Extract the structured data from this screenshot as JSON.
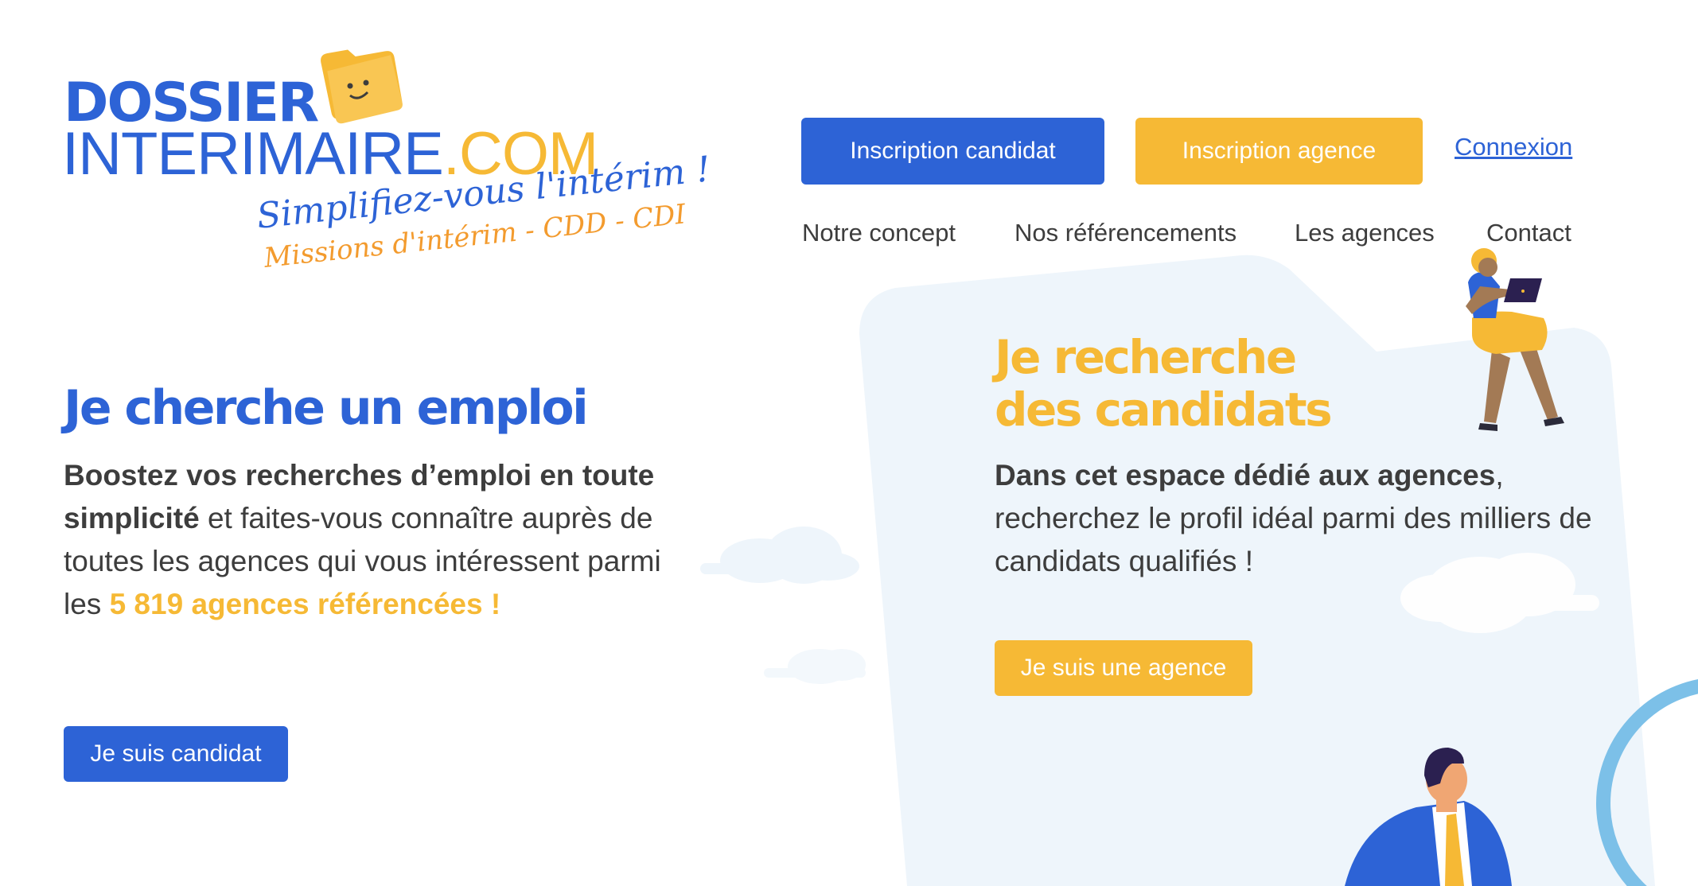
{
  "colors": {
    "brand_blue": "#2d63d6",
    "brand_yellow": "#f6b935",
    "brand_orange": "#f39b2e",
    "text": "#3d3d3d",
    "panel": "#eef5fb"
  },
  "logo": {
    "line1": "DOSSIER",
    "line2_main": "INTERIMAIRE",
    "line2_suffix": ".COM",
    "tagline": "Simplifiez-vous l'intérim !",
    "subtagline": "Missions d'intérim - CDD - CDI"
  },
  "header": {
    "inscription_candidat": "Inscription candidat",
    "inscription_agence": "Inscription agence",
    "connexion": "Connexion"
  },
  "nav": {
    "concept": "Notre concept",
    "referencements": "Nos référencements",
    "agences": "Les agences",
    "contact": "Contact"
  },
  "candidate": {
    "title": "Je cherche un emploi",
    "text_bold": "Boostez vos recherches d’emploi en toute simplicité",
    "text_regular": " et faites-vous connaître auprès de toutes les agences qui vous intéressent parmi les ",
    "text_highlight": "5 819 agences référencées !",
    "button": "Je suis candidat"
  },
  "agency": {
    "title_line1": "Je recherche",
    "title_line2": "des candidats",
    "text_bold": "Dans cet espace dédié aux agences",
    "text_regular": ", recherchez le profil idéal parmi des milliers de candidats qualifiés !",
    "button": "Je suis une agence"
  },
  "icons": {
    "logo_mascot": "folder-mascot-icon",
    "illustration_laptop": "person-with-laptop-illustration",
    "illustration_man": "businessman-illustration",
    "illustration_magnifier": "magnifier-illustration"
  }
}
